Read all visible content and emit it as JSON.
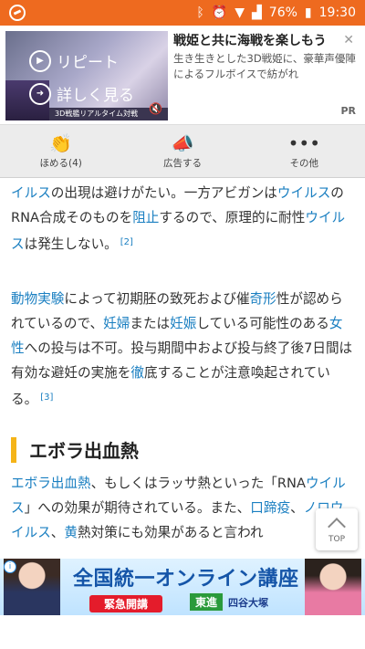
{
  "status_bar": {
    "battery": "76%",
    "time": "19:30"
  },
  "ad_top": {
    "btn_replay": "リピート",
    "btn_more": "詳しく見る",
    "thumb_logo": "",
    "thumb_strip": "3D戦艦リアルタイム対戦",
    "title": "戦姫と共に海戦を楽しもう",
    "description": "生き生きとした3D戦姫に、豪華声優陣によるフルボイスで紡がれ",
    "pr_label": "PR"
  },
  "actions": [
    {
      "icon": "clap-icon",
      "label": "ほめる(4)"
    },
    {
      "icon": "megaphone-icon",
      "label": "広告する"
    },
    {
      "icon": "more-icon",
      "label": "その他"
    }
  ],
  "article": {
    "p1_part1": "イルス",
    "p1_part2": "の出現は避けがたい。一方アビガンは",
    "p1_link2": "ウイルス",
    "p1_part3": "のRNA合成そのものを",
    "p1_link3": "阻止",
    "p1_part4": "するので、原理的に耐性",
    "p1_link4": "ウイルス",
    "p1_part5": "は発生しない。",
    "p1_ref": "[2]",
    "p2_link1": "動物実験",
    "p2_part1": "によって初期胚の致死および催",
    "p2_link2": "奇形",
    "p2_part2": "性が認められているので、",
    "p2_link3": "妊婦",
    "p2_part3": "または",
    "p2_link4": "妊娠",
    "p2_part4": "している可能性のある",
    "p2_link5": "女性",
    "p2_part5": "への投与は不可。投与期間中および投与終了後7日間は有効な避妊の実施を",
    "p2_link6": "徹",
    "p2_part6": "底することが注意喚起されている。",
    "p2_ref": "[3]",
    "heading": "エボラ出血熱",
    "p3_link1": "エボラ出血熱",
    "p3_part1": "、もしくはラッサ熱といった「RNA",
    "p3_link2": "ウイルス",
    "p3_part2": "」への効果が期待されている。また、",
    "p3_link3": "口蹄疫",
    "p3_part3": "、",
    "p3_link4": "ノロウイルス",
    "p3_part4": "、",
    "p3_link5": "黄",
    "p3_part5": "熱対策にも効果があると言われ"
  },
  "top_button": {
    "label": "TOP"
  },
  "banner": {
    "title": "全国統一オンライン講座",
    "pill": "緊急開講",
    "logo1": "東進",
    "logo2": "四谷大塚"
  }
}
